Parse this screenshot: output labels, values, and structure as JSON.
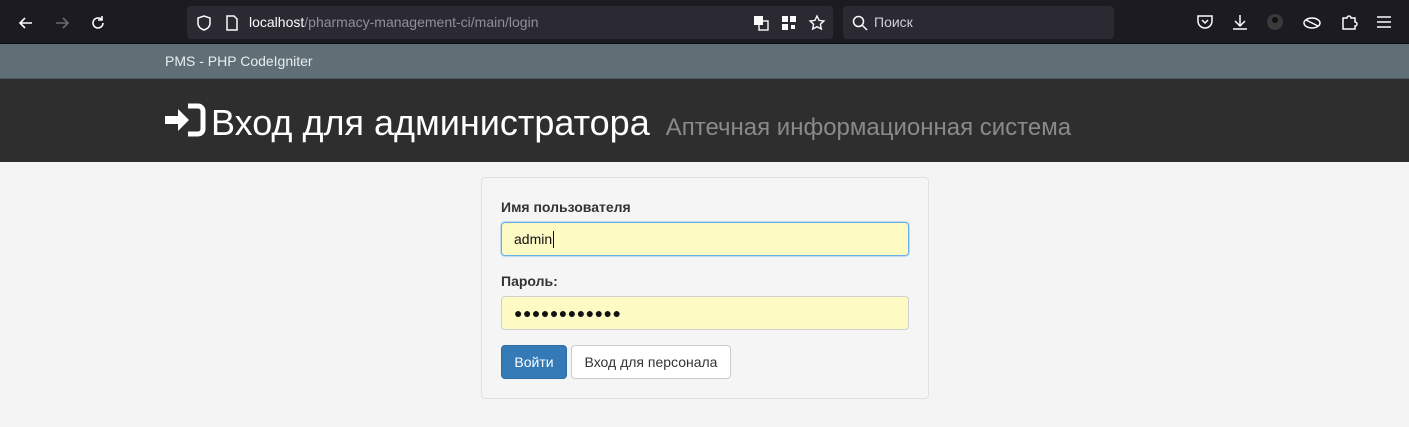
{
  "browser": {
    "url_host": "localhost",
    "url_path": "/pharmacy-management-ci/main/login",
    "search_placeholder": "Поиск",
    "icons": [
      "back-arrow-icon",
      "forward-arrow-icon",
      "reload-icon",
      "shield-icon",
      "page-icon",
      "translate-icon",
      "qr-code-icon",
      "star-icon",
      "search-icon",
      "pocket-icon",
      "download-icon",
      "profile-icon",
      "extension-icon",
      "puzzle-icon",
      "menu-icon"
    ]
  },
  "navbar": {
    "brand": "PMS - PHP CodeIgniter"
  },
  "header": {
    "icon": "sign-in-icon",
    "title": "Вход для администратора",
    "subtitle": "Аптечная информационная система"
  },
  "form": {
    "username_label": "Имя пользователя",
    "username_value": "admin",
    "password_label": "Пароль:",
    "password_mask": "●●●●●●●●●●●●",
    "login_button": "Войти",
    "staff_login_button": "Вход для персонала"
  },
  "colors": {
    "navbar": "#5f6f75",
    "header": "#2e2e2e",
    "primary": "#337ab7",
    "autofill": "#fefac4"
  }
}
